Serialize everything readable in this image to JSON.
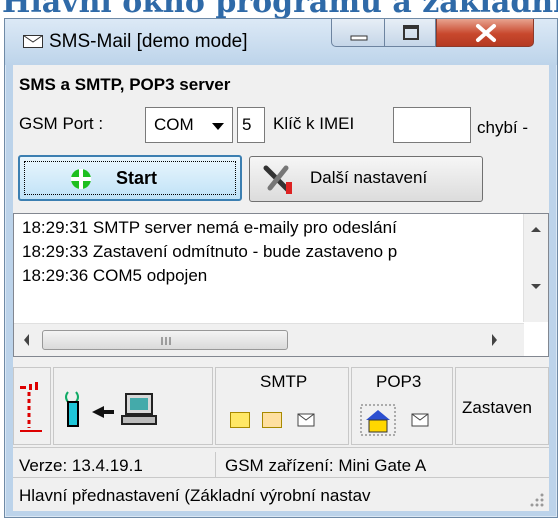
{
  "background_title": "Hlavní okno programu a základní",
  "window": {
    "title": "SMS-Mail  [demo mode]",
    "minimize": "minimize",
    "maximize": "maximize",
    "close": "close"
  },
  "server": {
    "header": "SMS a SMTP, POP3 server",
    "gsm_port_label": "GSM Port :",
    "port_value": "COM",
    "port_number": "5",
    "imei_label": "Klíč k IMEI",
    "imei_value": "",
    "missing": "chybí -"
  },
  "buttons": {
    "start": "Start",
    "more_settings": "Další nastavení"
  },
  "log": [
    "18:29:31  SMTP server nemá e-maily pro odeslání",
    "18:29:33  Zastavení odmítnuto - bude zastaveno p",
    "18:29:36  COM5 odpojen"
  ],
  "status_panels": {
    "smtp": "SMTP",
    "pop3": "POP3",
    "stopped": "Zastaven"
  },
  "statusbar": {
    "version": "Verze: 13.4.19.1",
    "gsm_device": "GSM zařízení: Mini Gate A",
    "preset": "Hlavní přednastavení (Základní výrobní nastav"
  },
  "colors": {
    "accent": "#3c7fb1",
    "start_icon": "#1fbf1f",
    "close_button": "#c8482d"
  }
}
